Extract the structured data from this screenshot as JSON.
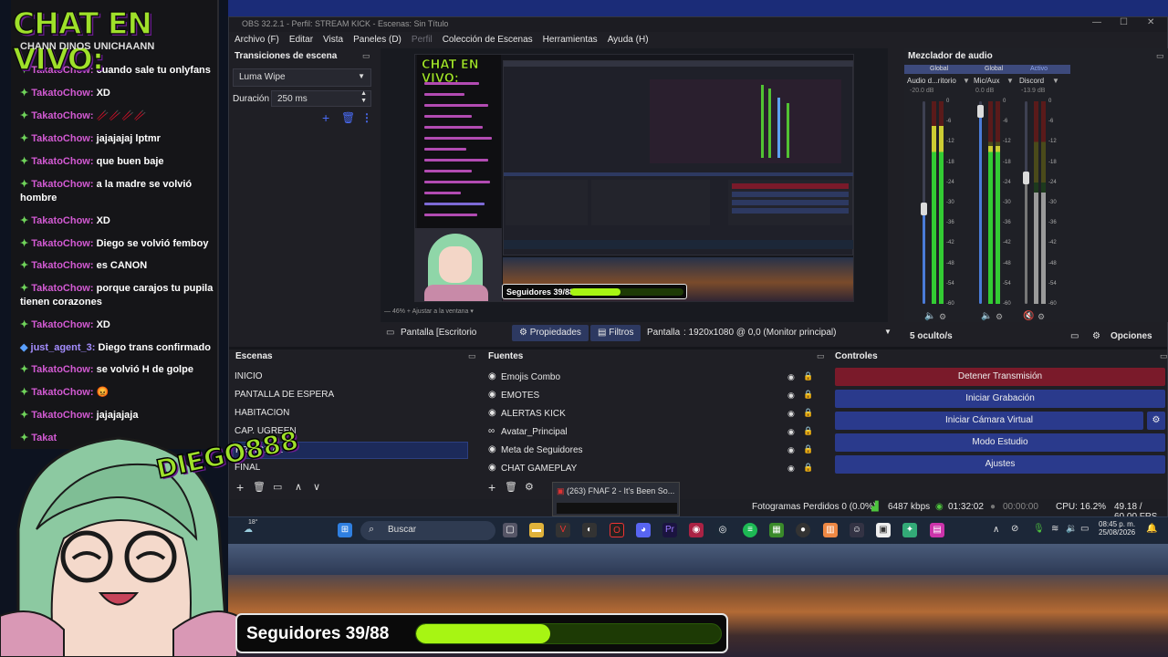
{
  "window": {
    "title": "OBS 32.2.1 - Perfil: STREAM KICK - Escenas: Sin Título"
  },
  "menu": [
    "Archivo (F)",
    "Editar",
    "Vista",
    "Paneles (D)",
    "Perfil",
    "Colección de Escenas",
    "Herramientas",
    "Ayuda (H)"
  ],
  "transitions": {
    "header": "Transiciones de escena",
    "selected": "Luma Wipe",
    "duration_label": "Duración",
    "duration_value": "250 ms"
  },
  "preview_badge": {
    "label": "Seguidores 39/88",
    "progress": 0.44
  },
  "preview_toolbar": {
    "source": "Pantalla [Escritorio",
    "properties": "Propiedades",
    "filters": "Filtros",
    "display_label": "Pantalla",
    "display_value": ": 1920x1080 @ 0,0 (Monitor principal)",
    "zoom": "46%",
    "fit": "Ajustar a la ventana"
  },
  "mixer": {
    "header": "Mezclador de audio",
    "columns": [
      "Global",
      "Global",
      "Activo"
    ],
    "channels": [
      {
        "name": "Audio d...ritorio",
        "db": "-20.0 dB",
        "level": 0.88,
        "fader": 0.47
      },
      {
        "name": "Mic/Aux",
        "db": "0.0 dB",
        "level": 0.78,
        "fader": 0.95
      },
      {
        "name": "Discord",
        "db": "-13.9 dB",
        "level": 0.55,
        "fader": 0.62
      }
    ],
    "ticks": [
      "0",
      "-6",
      "-12",
      "-18",
      "-24",
      "-30",
      "-36",
      "-42",
      "-48",
      "-54",
      "-60"
    ],
    "hidden": "5 oculto/s",
    "options": "Opciones"
  },
  "scenes": {
    "header": "Escenas",
    "items": [
      "INICIO",
      "PANTALLA DE ESPERA",
      "HABITACION",
      "CAP. UGREEN",
      "PRINCIPAL",
      "FINAL"
    ],
    "selected": "PRINCIPAL"
  },
  "sources": {
    "header": "Fuentes",
    "items": [
      "Emojis Combo",
      "EMOTES",
      "ALERTAS KICK",
      "Avatar_Principal",
      "Meta de Seguidores",
      "CHAT GAMEPLAY"
    ]
  },
  "controls": {
    "header": "Controles",
    "buttons": [
      "Detener Transmisión",
      "Iniciar Grabación",
      "Iniciar Cámara Virtual",
      "Modo Estudio",
      "Ajustes"
    ]
  },
  "status": {
    "dropped": "Fotogramas Perdidos 0 (0.0%)",
    "bitrate": "6487 kbps",
    "stream_time": "01:32:02",
    "rec_time": "00:00:00",
    "cpu": "CPU: 16.2%",
    "fps": "49.18 / 60.00 FPS"
  },
  "popup": {
    "title": "(263) FNAF 2 - It's Been So..."
  },
  "taskbar": {
    "weather": "18°",
    "search": "Buscar",
    "time": "08:45 p. m.",
    "date": "25/08/2026"
  },
  "chat": {
    "title": "CHAT EN VIVO:",
    "subtitle": "CHANN DINOS UNICHAANN",
    "messages": [
      {
        "user": "TakatoChow",
        "text": "cuando sale tu onlyfans"
      },
      {
        "user": "TakatoChow",
        "text": "XD"
      },
      {
        "user": "TakatoChow",
        "text": "🥢🥢🥢🥢"
      },
      {
        "user": "TakatoChow",
        "text": "jajajajaj lptmr"
      },
      {
        "user": "TakatoChow",
        "text": "que buen baje"
      },
      {
        "user": "TakatoChow",
        "text": "a la madre se volvió hombre"
      },
      {
        "user": "TakatoChow",
        "text": "XD"
      },
      {
        "user": "TakatoChow",
        "text": "Diego se volvió femboy"
      },
      {
        "user": "TakatoChow",
        "text": "es CANON"
      },
      {
        "user": "TakatoChow",
        "text": "porque carajos tu pupila tienen corazones"
      },
      {
        "user": "TakatoChow",
        "text": "XD"
      },
      {
        "user": "just_agent_3",
        "text": "Diego trans confirmado"
      },
      {
        "user": "TakatoChow",
        "text": "se volvió H de golpe"
      },
      {
        "user": "TakatoChow",
        "text": "😡"
      },
      {
        "user": "TakatoChow",
        "text": "jajajajaja"
      },
      {
        "user": "Takat",
        "text": ""
      }
    ]
  },
  "logo": "DIEGO888",
  "followers": {
    "label": "Seguidores 39/88",
    "progress": 0.44
  },
  "colors": {
    "accent": "#2d3961",
    "danger": "#7a1a2a",
    "lime": "#a7f513"
  }
}
